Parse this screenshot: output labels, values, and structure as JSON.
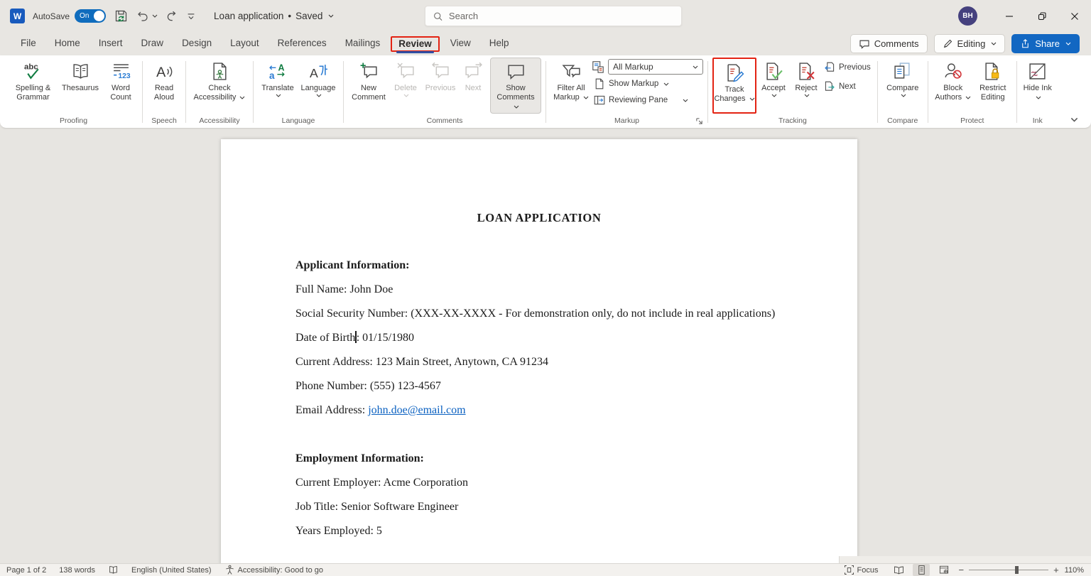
{
  "titlebar": {
    "autosave_label": "AutoSave",
    "autosave_state": "On",
    "doc_title": "Loan application",
    "separator": "•",
    "doc_status": "Saved",
    "search_placeholder": "Search",
    "avatar_initials": "BH"
  },
  "tab_bar": {
    "tabs": [
      "File",
      "Home",
      "Insert",
      "Draw",
      "Design",
      "Layout",
      "References",
      "Mailings",
      "Review",
      "View",
      "Help"
    ],
    "active_tab": "Review",
    "comments_button": "Comments",
    "editing_button": "Editing",
    "share_button": "Share"
  },
  "ribbon": {
    "proofing": {
      "label": "Proofing",
      "spelling": "Spelling & Grammar",
      "thesaurus": "Thesaurus",
      "word_count": "Word Count"
    },
    "speech": {
      "label": "Speech",
      "read_aloud": "Read Aloud"
    },
    "accessibility": {
      "label": "Accessibility",
      "check_accessibility": "Check Accessibility"
    },
    "language": {
      "label": "Language",
      "translate": "Translate",
      "language_btn": "Language"
    },
    "comments": {
      "label": "Comments",
      "new_comment": "New Comment",
      "delete": "Delete",
      "previous": "Previous",
      "next": "Next",
      "show_comments": "Show Comments"
    },
    "markup": {
      "label": "Markup",
      "filter_all_markup": "Filter All Markup",
      "markup_view_selected": "All Markup",
      "show_markup": "Show Markup",
      "reviewing_pane": "Reviewing Pane"
    },
    "tracking": {
      "label": "Tracking",
      "track_changes": "Track Changes",
      "accept": "Accept",
      "reject": "Reject",
      "previous": "Previous",
      "next": "Next"
    },
    "compare": {
      "label": "Compare",
      "compare_btn": "Compare"
    },
    "protect": {
      "label": "Protect",
      "block_authors": "Block Authors",
      "restrict_editing": "Restrict Editing"
    },
    "ink": {
      "label": "Ink",
      "hide_ink": "Hide Ink"
    }
  },
  "document": {
    "title": "LOAN APPLICATION",
    "applicant_heading": "Applicant Information:",
    "full_name": "Full Name: John Doe",
    "ssn": "Social Security Number: (XXX-XX-XXXX - For demonstration only, do not include in real applications)",
    "dob_before_cursor": "Date of Birth",
    "dob_after_cursor": ": 01/15/1980",
    "address": "Current Address: 123 Main Street, Anytown, CA 91234",
    "phone": "Phone Number: (555) 123-4567",
    "email_label": "Email Address: ",
    "email_link": "john.doe@email.com",
    "employment_heading": "Employment Information:",
    "employer": "Current Employer: Acme Corporation",
    "job_title": "Job Title: Senior Software Engineer",
    "years_employed": "Years Employed: 5"
  },
  "statusbar": {
    "page_indicator": "Page 1 of 2",
    "word_count": "138 words",
    "language": "English (United States)",
    "accessibility": "Accessibility: Good to go",
    "focus": "Focus",
    "zoom_level": "110%"
  },
  "annotations": {
    "highlight_color": "#e32313",
    "highlighted_elements": [
      "Review tab",
      "Track Changes button"
    ]
  },
  "colors": {
    "word_brand_blue": "#185abd",
    "share_button_blue": "#1267c2",
    "autosave_toggle_blue": "#0f6cbd",
    "active_tab_underline": "#2f4fa5",
    "hyperlink_blue": "#0b61c1",
    "avatar_purple": "#45417e"
  },
  "icon_glyphs": {
    "word-logo": "blue square with W",
    "autosave-toggle": "blue pill switch",
    "save-icon": "floppy disk with green sync arrows",
    "undo-icon": "curved arrow left",
    "redo-icon": "circular arrow",
    "search-icon": "magnifier",
    "minimize-icon": "dash",
    "restore-icon": "overlapping squares",
    "close-icon": "x",
    "comment-icon": "speech bubble",
    "pencil-icon": "pencil",
    "share-icon": "box with up arrow",
    "spelling-icon": "abc over green check",
    "thesaurus-icon": "open book",
    "word-count-icon": "lines with 123",
    "read-aloud-icon": "letter A with sound waves",
    "check-accessibility-icon": "document with person",
    "translate-icon": "letters with swap arrows",
    "language-icon": "A with hangul",
    "new-comment-icon": "bubble with plus",
    "delete-comment-icon": "bubble with x",
    "filter-markup-icon": "funnel with bubble",
    "show-markup-icon": "page with fold",
    "reviewing-pane-icon": "split pane with arrow",
    "track-changes-icon": "page with pencil",
    "accept-icon": "page with green check",
    "reject-icon": "page with red x",
    "compare-icon": "two documents",
    "block-authors-icon": "person with no symbol",
    "restrict-editing-icon": "page with yellow lock",
    "hide-ink-icon": "square with red scribbles",
    "dialog-launcher-icon": "corner arrow",
    "focus-icon": "page with corner brackets",
    "read-mode-icon": "open book",
    "print-layout-icon": "page with lines",
    "web-layout-icon": "page with globe"
  }
}
